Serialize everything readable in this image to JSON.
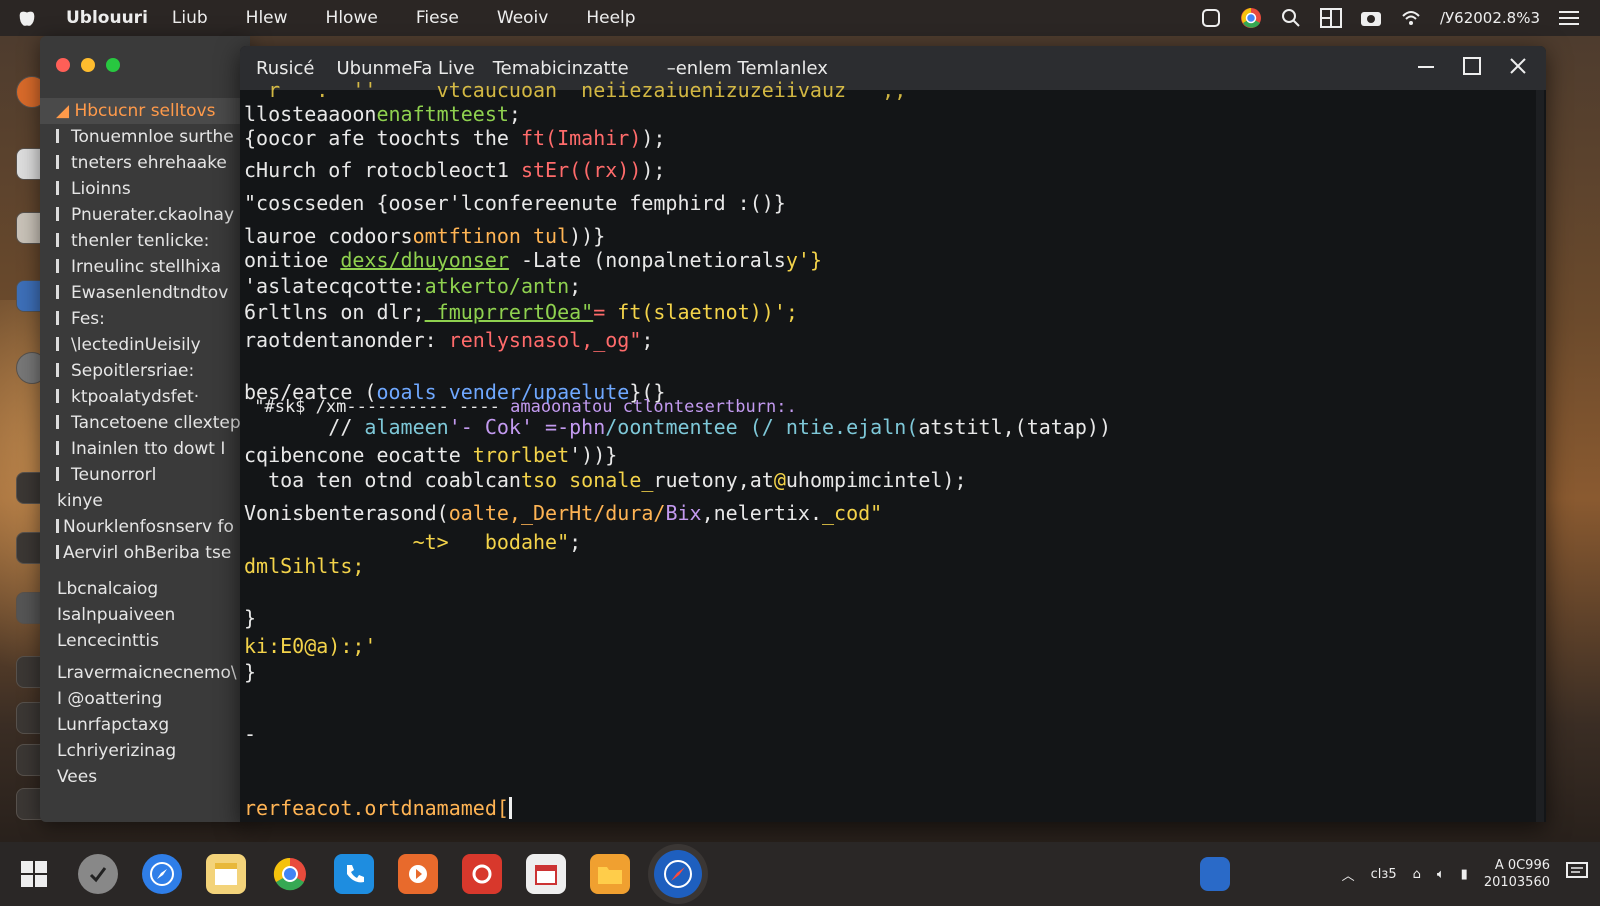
{
  "menubar": {
    "app_name": "Ublouuri",
    "menus": [
      "Liub",
      "Hlew",
      "Hlowe",
      "Fiese",
      "Weoiv",
      "Heelp"
    ],
    "status_text": "/У62002.8%3"
  },
  "sidebar": {
    "selected": "Hbcucnr selltovs",
    "items": [
      "Tonuemnloe surthe",
      "tneters ehrehaake",
      "Lioinns",
      "Pnuerater.ckaolnay",
      "thenler tenlicke:",
      "Irneulinc stellhixa",
      "Ewasenlendtndtov",
      "Fes:",
      "\\lectedinUeisily",
      "Sepoitlersriae:",
      "ktpoalatydsfet·",
      "Tancetoene cllextep:",
      "Inainlen tto dowt I",
      "Teunorrorl",
      "kinye",
      "Nourklenfosnserv fo",
      "Aervirl ohBeriba tse"
    ],
    "groups": [
      "Lbcnalcaiog",
      "Isalnpuaiveen",
      "Lencecinttis",
      "Lravermaicnecnemo\\",
      "I @oattering",
      "Lunrfapctaxg",
      "Lchriyerizinag",
      "Vees"
    ]
  },
  "terminal": {
    "tabs": [
      "Rusicé",
      "UbunmeFa Live",
      "Temabicinzatte",
      "–enlem Temlanlex"
    ],
    "lines": {
      "l0": "  r   .  ''     vtcaucuoan  neiiezaiuenizuzeiivauz   ,,",
      "l1a": "llosteaaoon",
      "l1b": "enaftmteest",
      "l1c": ";",
      "l2a": "{oocor afe toochts the ",
      "l2b": "ft(Imahir)",
      "l2c": ");",
      "l3a": "cHurch of rotocbleoct1 ",
      "l3b": "stEr((rx))",
      "l3c": ");",
      "l4": "\"coscseden {ooser'lconfereenute femphird :()}",
      "l5a": "lauroe codoors",
      "l5b": "omtftinon tul",
      "l5c": "))}",
      "l6a": "onitioe ",
      "l6b": "dexs/dhuyonser",
      "l6c": " -Late (nonpalnetiorals",
      "l6d": "y'}",
      "l7a": "'aslatecqcotte:",
      "l7b": "atkerto/antn",
      "l7c": ";",
      "l8a": "6rltlns on dlr;",
      "l8b": " fmuprrertOea\"",
      "l8c": "= ",
      "l8d": "ft(slaetnot)",
      "l8e": ")';",
      "l9a": "raotdentanonder: ",
      "l9b": "renlysnasol,_og\"",
      "l9c": ";",
      "l10a": "bes/eatce (",
      "l10b": "ooals vender/upaelute",
      "l10c": "}(}",
      "l11a": " \"#sk$ /xm---------- ---- ",
      "l11b": "amaoonatou ctlontesertburn:.",
      "l12a": "       // ",
      "l12b": "alameen",
      "l12c": "'- Cok' ",
      "l12d": "=-phn",
      "l12e": "/oontmentee (/ ntie.ejaln(",
      "l12f": "atstitl,(tatap))",
      "l13a": "cqibencone eocatte ",
      "l13b": "trorlbet",
      "l13c": "'))}",
      "l14a": "  toa ten otnd coablcan",
      "l14b": "tso sonale_",
      "l14c": "ruetony,at",
      "l14d": "@",
      "l14e": "uhompimcintel);",
      "l15a": "Vonisbenterasond(",
      "l15b": "oalte,_DerHt/dura/",
      "l15c": "Bix",
      "l15d": ",nelertix.",
      "l15e": "_cod\"",
      "l16a": "              ~t>   ",
      "l16b": "bodahe\"",
      "l16c": ";",
      "l17": "dmlSihlts;",
      "l18": "}",
      "l19": "ki:E0@a):;'",
      "l20": "}",
      "l21": "-",
      "l22": "rerfeacot.ortdnamamed["
    }
  },
  "taskbar": {
    "clock_line1": "A 0C996",
    "clock_line2": "20103560",
    "tray_text": "clɜ5"
  }
}
